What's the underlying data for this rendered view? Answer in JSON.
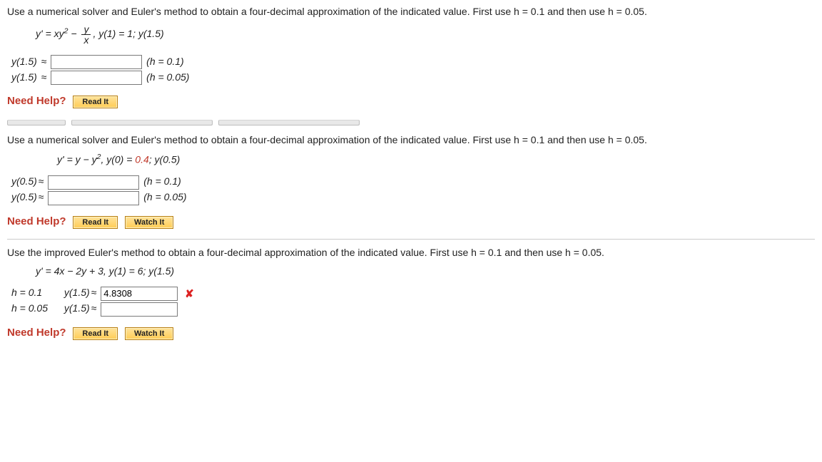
{
  "q1": {
    "prompt": "Use a numerical solver and Euler's method to obtain a four-decimal approximation of the indicated value. First use h = 0.1 and then use h = 0.05.",
    "eqn_lhs_1": "y' = xy",
    "eqn_lhs_2": " − ",
    "frac_num": "y",
    "frac_den": "x",
    "eqn_rhs": ",   y(1) = 1; y(1.5)",
    "rows": [
      {
        "label": "y(1.5)",
        "after": "(h = 0.1)"
      },
      {
        "label": "y(1.5)",
        "after": "(h = 0.05)"
      }
    ]
  },
  "q2": {
    "prompt": "Use a numerical solver and Euler's method to obtain a four-decimal approximation of the indicated value. First use h = 0.1 and then use h = 0.05.",
    "eqn_a": "y' = y − y",
    "eqn_b": ", y(0) = ",
    "eqn_hl": "0.4",
    "eqn_c": ";   y(0.5)",
    "rows": [
      {
        "label": "y(0.5)",
        "after": "(h = 0.1)"
      },
      {
        "label": "y(0.5)",
        "after": "(h = 0.05)"
      }
    ]
  },
  "q3": {
    "prompt": "Use the improved Euler's method to obtain a four-decimal approximation of the indicated value. First use h = 0.1 and then use h = 0.05.",
    "eqn": "y' = 4x − 2y + 3, y(1) = 6;  y(1.5)",
    "rows": [
      {
        "pre": "h = 0.1",
        "label": "y(1.5)",
        "value": "4.8308",
        "incorrect": true
      },
      {
        "pre": "h = 0.05",
        "label": "y(1.5)",
        "value": ""
      }
    ]
  },
  "help": {
    "label": "Need Help?",
    "read": "Read It",
    "watch": "Watch It"
  }
}
